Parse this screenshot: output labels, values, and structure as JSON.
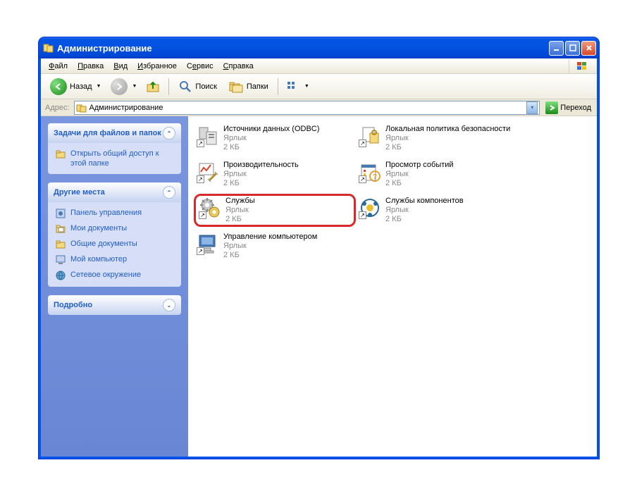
{
  "window": {
    "title": "Администрирование"
  },
  "menu": {
    "file": "Файл",
    "edit": "Правка",
    "view": "Вид",
    "favorites": "Избранное",
    "tools": "Сервис",
    "help": "Справка"
  },
  "toolbar": {
    "back": "Назад",
    "search": "Поиск",
    "folders": "Папки"
  },
  "address": {
    "label": "Адрес:",
    "value": "Администрирование",
    "go": "Переход"
  },
  "sidebar": {
    "tasks": {
      "title": "Задачи для файлов и папок",
      "items": [
        {
          "label": "Открыть общий доступ к этой папке"
        }
      ]
    },
    "places": {
      "title": "Другие места",
      "items": [
        {
          "label": "Панель управления"
        },
        {
          "label": "Мои документы"
        },
        {
          "label": "Общие документы"
        },
        {
          "label": "Мой компьютер"
        },
        {
          "label": "Сетевое окружение"
        }
      ]
    },
    "details": {
      "title": "Подробно"
    }
  },
  "items": [
    {
      "name": "Источники данных (ODBC)",
      "type": "Ярлык",
      "size": "2 КБ",
      "icon": "odbc"
    },
    {
      "name": "Локальная политика безопасности",
      "type": "Ярлык",
      "size": "2 КБ",
      "icon": "security"
    },
    {
      "name": "Производительность",
      "type": "Ярлык",
      "size": "2 КБ",
      "icon": "perf"
    },
    {
      "name": "Просмотр событий",
      "type": "Ярлык",
      "size": "2 КБ",
      "icon": "events"
    },
    {
      "name": "Службы",
      "type": "Ярлык",
      "size": "2 КБ",
      "icon": "services",
      "highlighted": true
    },
    {
      "name": "Службы компонентов",
      "type": "Ярлык",
      "size": "2 КБ",
      "icon": "component"
    },
    {
      "name": "Управление компьютером",
      "type": "Ярлык",
      "size": "2 КБ",
      "icon": "mgmt"
    }
  ]
}
